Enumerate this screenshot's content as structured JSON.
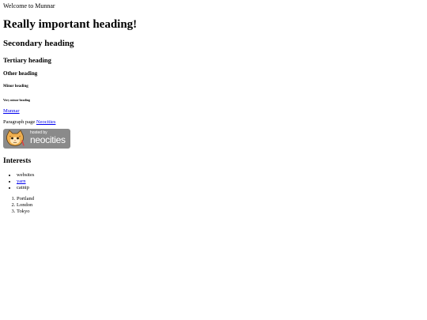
{
  "welcome_text": "Welcome to Munnar",
  "headings": {
    "h1": "Really important heading!",
    "h2": "Secondary heading",
    "h3": "Tertiary heading",
    "h4": "Other heading",
    "h5": "Minor heading",
    "h6": "Very minor heading"
  },
  "munnar_link": "Munnar",
  "paragraph": {
    "text": "Paragraph page",
    "link": "Neocities"
  },
  "badge": {
    "small_text": "hosted by",
    "big_text": "neocities",
    "icon": "neocities-cat-icon"
  },
  "interests": {
    "heading": "Interests",
    "unordered": [
      "websites",
      "yarn",
      "catnip"
    ],
    "ordered": [
      "Portland",
      "London",
      "Tokyo"
    ]
  },
  "colors": {
    "link": "#0000ee",
    "badge_bg": "#8a8a8a"
  }
}
